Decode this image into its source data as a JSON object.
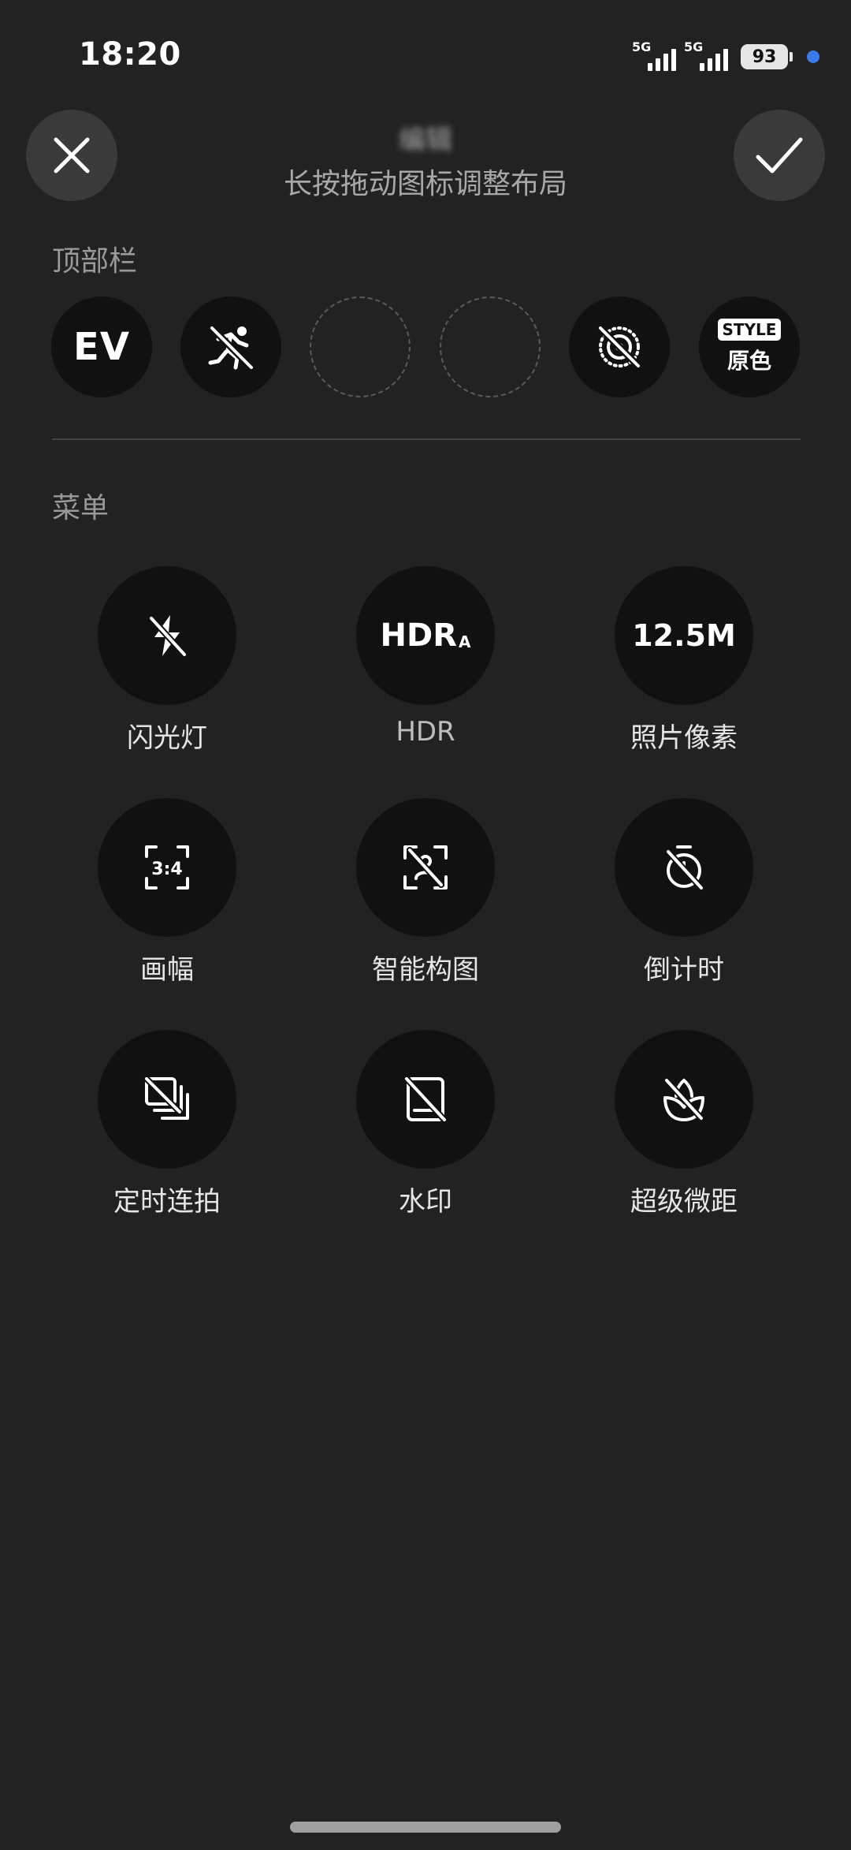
{
  "status_bar": {
    "time": "18:20",
    "signal1_label": "5G",
    "signal2_label": "5G",
    "battery": "93",
    "indicator_color": "#3a7be8"
  },
  "header": {
    "title": "编辑",
    "hint": "长按拖动图标调整布局",
    "close_icon": "close-icon",
    "confirm_icon": "check-icon"
  },
  "top_bar": {
    "label": "顶部栏",
    "slots": [
      {
        "type": "text",
        "text": "EV"
      },
      {
        "type": "icon",
        "icon": "motion-off-icon"
      },
      {
        "type": "empty"
      },
      {
        "type": "empty"
      },
      {
        "type": "icon",
        "icon": "live-photo-off-icon"
      },
      {
        "type": "style",
        "tag": "STYLE",
        "sub": "原色"
      }
    ]
  },
  "menu": {
    "label": "菜单",
    "items": [
      {
        "label": "闪光灯",
        "icon": "flash-off-icon"
      },
      {
        "label": "HDR",
        "icon_text": "HDR",
        "icon_sub": "A"
      },
      {
        "label": "照片像素",
        "icon_text": "12.5M"
      },
      {
        "label": "画幅",
        "icon_text": "3:4"
      },
      {
        "label": "智能构图",
        "icon": "smart-composition-off-icon"
      },
      {
        "label": "倒计时",
        "icon": "timer-off-icon"
      },
      {
        "label": "定时连拍",
        "icon": "burst-off-icon"
      },
      {
        "label": "水印",
        "icon": "watermark-off-icon"
      },
      {
        "label": "超级微距",
        "icon": "macro-off-icon"
      }
    ]
  }
}
